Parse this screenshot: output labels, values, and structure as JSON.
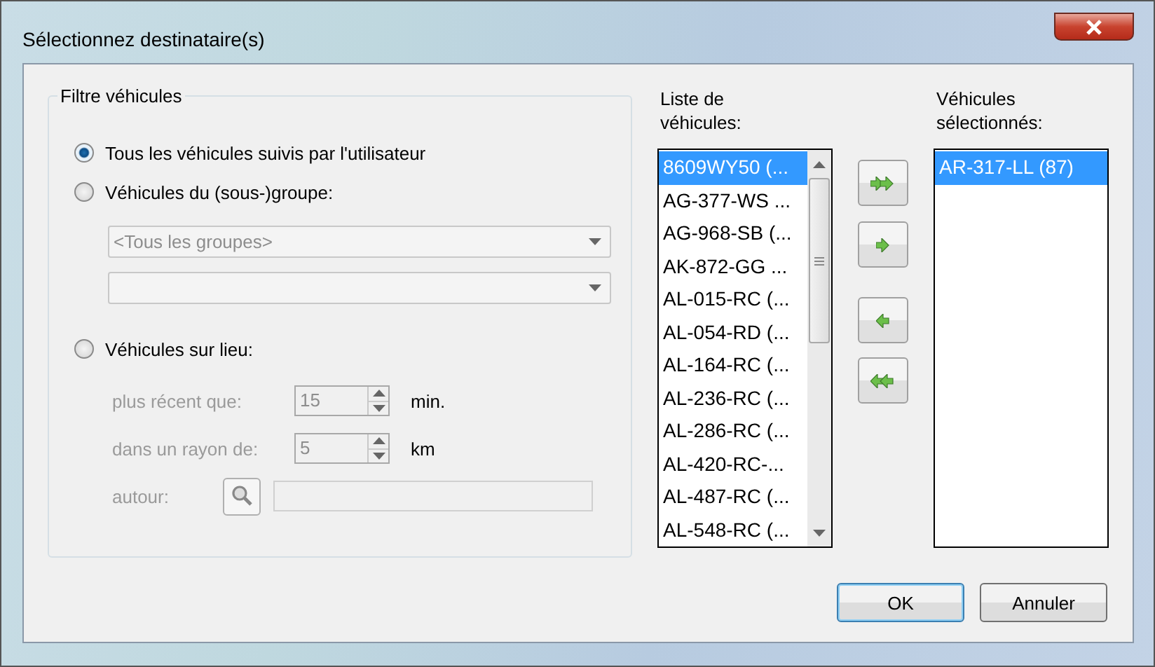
{
  "window": {
    "title": "Sélectionnez destinataire(s)"
  },
  "filter": {
    "title": "Filtre véhicules",
    "options": [
      {
        "label": "Tous les véhicules suivis par l'utilisateur",
        "selected": true
      },
      {
        "label": "Véhicules du (sous-)groupe:",
        "selected": false
      },
      {
        "label": "Véhicules sur lieu:",
        "selected": false
      }
    ],
    "group_combos": [
      {
        "value": "<Tous les groupes>",
        "disabled": true
      },
      {
        "disabled": true
      }
    ],
    "spinners": [
      {
        "label": "plus récent que:",
        "value": "15",
        "unit": "min.",
        "disabled": true
      },
      {
        "label": "dans un rayon de:",
        "value": "5",
        "unit": "km",
        "disabled": true
      }
    ],
    "around": {
      "label": "autour:",
      "disabled": true
    }
  },
  "vehicle_list": {
    "title": "Liste de véhicules:",
    "items": [
      {
        "label": "8609WY50 (...",
        "selected": true
      },
      {
        "label": "AG-377-WS ...",
        "selected": false
      },
      {
        "label": "AG-968-SB (...",
        "selected": false
      },
      {
        "label": "AK-872-GG ...",
        "selected": false
      },
      {
        "label": "AL-015-RC (...",
        "selected": false
      },
      {
        "label": "AL-054-RD (...",
        "selected": false
      },
      {
        "label": "AL-164-RC (...",
        "selected": false
      },
      {
        "label": "AL-236-RC (...",
        "selected": false
      },
      {
        "label": "AL-286-RC (...",
        "selected": false
      },
      {
        "label": "AL-420-RC-...",
        "selected": false
      },
      {
        "label": "AL-487-RC (...",
        "selected": false
      },
      {
        "label": "AL-548-RC (...",
        "selected": false
      }
    ]
  },
  "transfer_buttons": [
    {
      "kind": "add_all"
    },
    {
      "kind": "add"
    },
    {
      "kind": "remove"
    },
    {
      "kind": "remove_all"
    }
  ],
  "selected_list": {
    "title": "Véhicules sélectionnés:",
    "items": [
      {
        "label": "AR-317-LL (87)",
        "selected": true
      }
    ]
  },
  "buttons": [
    {
      "label": "OK",
      "default": true
    },
    {
      "label": "Annuler",
      "default": false
    }
  ]
}
